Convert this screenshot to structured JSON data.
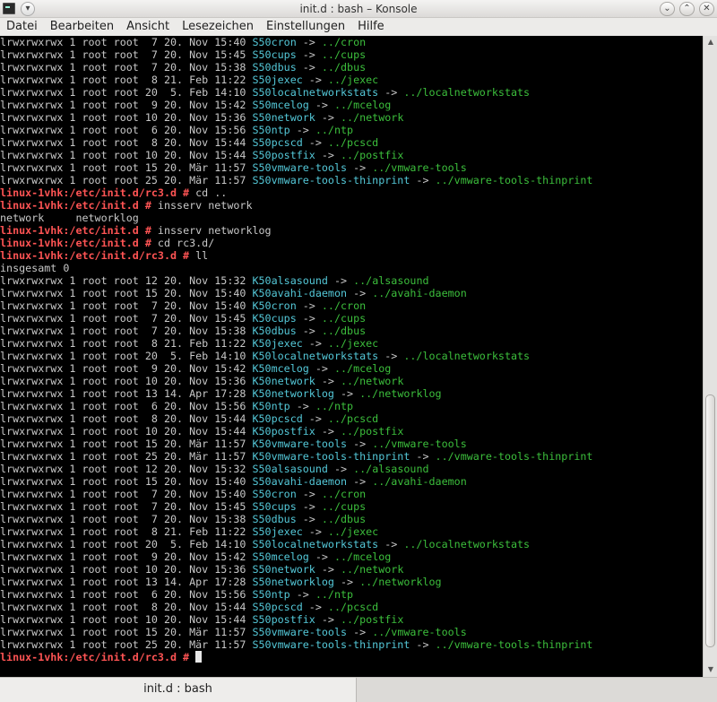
{
  "window": {
    "title": "init.d : bash – Konsole",
    "menu_button": "▾",
    "controls": {
      "minimize": "⌄",
      "maximize": "⌃",
      "close": "✕"
    }
  },
  "menubar": {
    "items": [
      "Datei",
      "Bearbeiten",
      "Ansicht",
      "Lesezeichen",
      "Einstellungen",
      "Hilfe"
    ]
  },
  "terminal": {
    "lines": [
      {
        "t": "l",
        "p": "lrwxrwxrwx 1 root root  7 20. Nov 15:40 ",
        "n": "S50cron",
        "a": " -> ",
        "g": "../cron"
      },
      {
        "t": "l",
        "p": "lrwxrwxrwx 1 root root  7 20. Nov 15:45 ",
        "n": "S50cups",
        "a": " -> ",
        "g": "../cups"
      },
      {
        "t": "l",
        "p": "lrwxrwxrwx 1 root root  7 20. Nov 15:38 ",
        "n": "S50dbus",
        "a": " -> ",
        "g": "../dbus"
      },
      {
        "t": "l",
        "p": "lrwxrwxrwx 1 root root  8 21. Feb 11:22 ",
        "n": "S50jexec",
        "a": " -> ",
        "g": "../jexec"
      },
      {
        "t": "l",
        "p": "lrwxrwxrwx 1 root root 20  5. Feb 14:10 ",
        "n": "S50localnetworkstats",
        "a": " -> ",
        "g": "../localnetworkstats"
      },
      {
        "t": "l",
        "p": "lrwxrwxrwx 1 root root  9 20. Nov 15:42 ",
        "n": "S50mcelog",
        "a": " -> ",
        "g": "../mcelog"
      },
      {
        "t": "l",
        "p": "lrwxrwxrwx 1 root root 10 20. Nov 15:36 ",
        "n": "S50network",
        "a": " -> ",
        "g": "../network"
      },
      {
        "t": "l",
        "p": "lrwxrwxrwx 1 root root  6 20. Nov 15:56 ",
        "n": "S50ntp",
        "a": " -> ",
        "g": "../ntp"
      },
      {
        "t": "l",
        "p": "lrwxrwxrwx 1 root root  8 20. Nov 15:44 ",
        "n": "S50pcscd",
        "a": " -> ",
        "g": "../pcscd"
      },
      {
        "t": "l",
        "p": "lrwxrwxrwx 1 root root 10 20. Nov 15:44 ",
        "n": "S50postfix",
        "a": " -> ",
        "g": "../postfix"
      },
      {
        "t": "l",
        "p": "lrwxrwxrwx 1 root root 15 20. Mär 11:57 ",
        "n": "S50vmware-tools",
        "a": " -> ",
        "g": "../vmware-tools"
      },
      {
        "t": "l",
        "p": "lrwxrwxrwx 1 root root 25 20. Mär 11:57 ",
        "n": "S50vmware-tools-thinprint",
        "a": " -> ",
        "g": "../vmware-tools-thinprint"
      },
      {
        "t": "c",
        "pr": "linux-1vhk:/etc/init.d/rc3.d #",
        "cmd": " cd .."
      },
      {
        "t": "c",
        "pr": "linux-1vhk:/etc/init.d #",
        "cmd": " insserv network"
      },
      {
        "t": "o",
        "text": "network     networklog"
      },
      {
        "t": "c",
        "pr": "linux-1vhk:/etc/init.d #",
        "cmd": " insserv networklog"
      },
      {
        "t": "c",
        "pr": "linux-1vhk:/etc/init.d #",
        "cmd": " cd rc3.d/"
      },
      {
        "t": "c",
        "pr": "linux-1vhk:/etc/init.d/rc3.d #",
        "cmd": " ll"
      },
      {
        "t": "o",
        "text": "insgesamt 0"
      },
      {
        "t": "l",
        "p": "lrwxrwxrwx 1 root root 12 20. Nov 15:32 ",
        "n": "K50alsasound",
        "a": " -> ",
        "g": "../alsasound"
      },
      {
        "t": "l",
        "p": "lrwxrwxrwx 1 root root 15 20. Nov 15:40 ",
        "n": "K50avahi-daemon",
        "a": " -> ",
        "g": "../avahi-daemon"
      },
      {
        "t": "l",
        "p": "lrwxrwxrwx 1 root root  7 20. Nov 15:40 ",
        "n": "K50cron",
        "a": " -> ",
        "g": "../cron"
      },
      {
        "t": "l",
        "p": "lrwxrwxrwx 1 root root  7 20. Nov 15:45 ",
        "n": "K50cups",
        "a": " -> ",
        "g": "../cups"
      },
      {
        "t": "l",
        "p": "lrwxrwxrwx 1 root root  7 20. Nov 15:38 ",
        "n": "K50dbus",
        "a": " -> ",
        "g": "../dbus"
      },
      {
        "t": "l",
        "p": "lrwxrwxrwx 1 root root  8 21. Feb 11:22 ",
        "n": "K50jexec",
        "a": " -> ",
        "g": "../jexec"
      },
      {
        "t": "l",
        "p": "lrwxrwxrwx 1 root root 20  5. Feb 14:10 ",
        "n": "K50localnetworkstats",
        "a": " -> ",
        "g": "../localnetworkstats"
      },
      {
        "t": "l",
        "p": "lrwxrwxrwx 1 root root  9 20. Nov 15:42 ",
        "n": "K50mcelog",
        "a": " -> ",
        "g": "../mcelog"
      },
      {
        "t": "l",
        "p": "lrwxrwxrwx 1 root root 10 20. Nov 15:36 ",
        "n": "K50network",
        "a": " -> ",
        "g": "../network"
      },
      {
        "t": "l",
        "p": "lrwxrwxrwx 1 root root 13 14. Apr 17:28 ",
        "n": "K50networklog",
        "a": " -> ",
        "g": "../networklog"
      },
      {
        "t": "l",
        "p": "lrwxrwxrwx 1 root root  6 20. Nov 15:56 ",
        "n": "K50ntp",
        "a": " -> ",
        "g": "../ntp"
      },
      {
        "t": "l",
        "p": "lrwxrwxrwx 1 root root  8 20. Nov 15:44 ",
        "n": "K50pcscd",
        "a": " -> ",
        "g": "../pcscd"
      },
      {
        "t": "l",
        "p": "lrwxrwxrwx 1 root root 10 20. Nov 15:44 ",
        "n": "K50postfix",
        "a": " -> ",
        "g": "../postfix"
      },
      {
        "t": "l",
        "p": "lrwxrwxrwx 1 root root 15 20. Mär 11:57 ",
        "n": "K50vmware-tools",
        "a": " -> ",
        "g": "../vmware-tools"
      },
      {
        "t": "l",
        "p": "lrwxrwxrwx 1 root root 25 20. Mär 11:57 ",
        "n": "K50vmware-tools-thinprint",
        "a": " -> ",
        "g": "../vmware-tools-thinprint"
      },
      {
        "t": "l",
        "p": "lrwxrwxrwx 1 root root 12 20. Nov 15:32 ",
        "n": "S50alsasound",
        "a": " -> ",
        "g": "../alsasound"
      },
      {
        "t": "l",
        "p": "lrwxrwxrwx 1 root root 15 20. Nov 15:40 ",
        "n": "S50avahi-daemon",
        "a": " -> ",
        "g": "../avahi-daemon"
      },
      {
        "t": "l",
        "p": "lrwxrwxrwx 1 root root  7 20. Nov 15:40 ",
        "n": "S50cron",
        "a": " -> ",
        "g": "../cron"
      },
      {
        "t": "l",
        "p": "lrwxrwxrwx 1 root root  7 20. Nov 15:45 ",
        "n": "S50cups",
        "a": " -> ",
        "g": "../cups"
      },
      {
        "t": "l",
        "p": "lrwxrwxrwx 1 root root  7 20. Nov 15:38 ",
        "n": "S50dbus",
        "a": " -> ",
        "g": "../dbus"
      },
      {
        "t": "l",
        "p": "lrwxrwxrwx 1 root root  8 21. Feb 11:22 ",
        "n": "S50jexec",
        "a": " -> ",
        "g": "../jexec"
      },
      {
        "t": "l",
        "p": "lrwxrwxrwx 1 root root 20  5. Feb 14:10 ",
        "n": "S50localnetworkstats",
        "a": " -> ",
        "g": "../localnetworkstats"
      },
      {
        "t": "l",
        "p": "lrwxrwxrwx 1 root root  9 20. Nov 15:42 ",
        "n": "S50mcelog",
        "a": " -> ",
        "g": "../mcelog"
      },
      {
        "t": "l",
        "p": "lrwxrwxrwx 1 root root 10 20. Nov 15:36 ",
        "n": "S50network",
        "a": " -> ",
        "g": "../network"
      },
      {
        "t": "l",
        "p": "lrwxrwxrwx 1 root root 13 14. Apr 17:28 ",
        "n": "S50networklog",
        "a": " -> ",
        "g": "../networklog"
      },
      {
        "t": "l",
        "p": "lrwxrwxrwx 1 root root  6 20. Nov 15:56 ",
        "n": "S50ntp",
        "a": " -> ",
        "g": "../ntp"
      },
      {
        "t": "l",
        "p": "lrwxrwxrwx 1 root root  8 20. Nov 15:44 ",
        "n": "S50pcscd",
        "a": " -> ",
        "g": "../pcscd"
      },
      {
        "t": "l",
        "p": "lrwxrwxrwx 1 root root 10 20. Nov 15:44 ",
        "n": "S50postfix",
        "a": " -> ",
        "g": "../postfix"
      },
      {
        "t": "l",
        "p": "lrwxrwxrwx 1 root root 15 20. Mär 11:57 ",
        "n": "S50vmware-tools",
        "a": " -> ",
        "g": "../vmware-tools"
      },
      {
        "t": "l",
        "p": "lrwxrwxrwx 1 root root 25 20. Mär 11:57 ",
        "n": "S50vmware-tools-thinprint",
        "a": " -> ",
        "g": "../vmware-tools-thinprint"
      },
      {
        "t": "c",
        "pr": "linux-1vhk:/etc/init.d/rc3.d #",
        "cmd": " ",
        "cursor": true
      }
    ]
  },
  "scrollbar": {
    "up_arrow": "▲",
    "down_arrow": "▼"
  },
  "tabs": [
    {
      "label": "init.d : bash"
    }
  ],
  "colors": {
    "terminal_bg": "#000000",
    "prompt": "#ff5454",
    "symlink_name": "#54c8d8",
    "symlink_target": "#3cbf3c",
    "text": "#c8c8c8"
  }
}
